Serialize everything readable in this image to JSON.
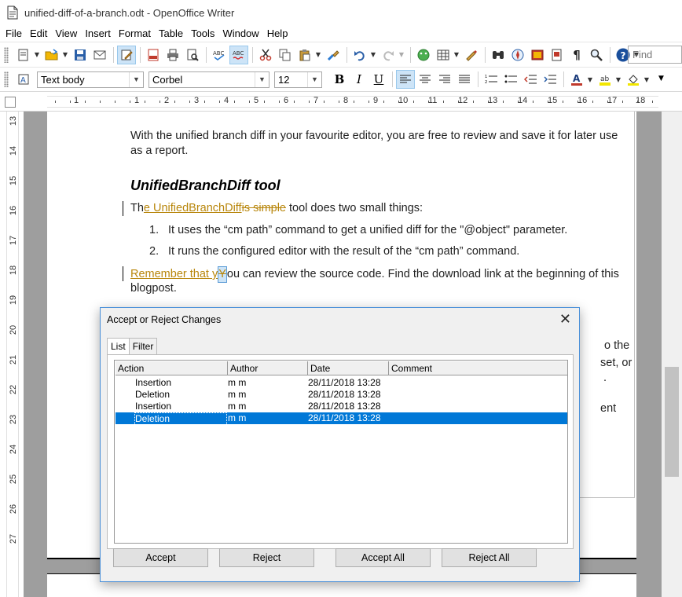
{
  "window": {
    "title": "unified-diff-of-a-branch.odt - OpenOffice Writer"
  },
  "menu": [
    "File",
    "Edit",
    "View",
    "Insert",
    "Format",
    "Table",
    "Tools",
    "Window",
    "Help"
  ],
  "toolbar": {
    "find_placeholder": "Find",
    "paragraph_style": "Text body",
    "font_name": "Corbel",
    "font_size": "12"
  },
  "ruler": {
    "top_numbers": [
      "1",
      "1",
      "2",
      "3",
      "4",
      "5",
      "6",
      "7",
      "8",
      "9",
      "10",
      "11",
      "12",
      "13",
      "14",
      "15",
      "16",
      "17",
      "18"
    ],
    "left_numbers": [
      "13",
      "14",
      "15",
      "16",
      "17",
      "18",
      "19",
      "20",
      "21",
      "22",
      "23",
      "24",
      "25",
      "26",
      "27"
    ]
  },
  "document": {
    "p1": "With the unified branch diff in your favourite editor, you are free to review and save it for later use",
    "p1b": "as a report.",
    "heading": "UnifiedBranchDiff tool",
    "p2_a": "Th",
    "p2_ins": "e UnifiedBranchDiff",
    "p2_del": "is simple",
    "p2_b": " tool does two small things:",
    "li1_num": "1.",
    "li1": "It uses the “cm path” command to get a unified diff for the \"@object\" parameter.",
    "li2_num": "2.",
    "li2": "It runs the configured editor with the result of the “cm path” command.",
    "p3_ins": "Remember that y",
    "p3_cursor": "Y",
    "p3_rest": "ou can review the source code. Find the download link at the beginning of this",
    "p3b": "blogpost.",
    "hidden_1": "o the",
    "hidden_2": "set, or",
    "hidden_3": ".",
    "hidden_4": "ent"
  },
  "dialog": {
    "title": "Accept or Reject Changes",
    "tabs": [
      "List",
      "Filter"
    ],
    "columns": [
      "Action",
      "Author",
      "Date",
      "Comment"
    ],
    "rows": [
      {
        "action": "Insertion",
        "author": "m m",
        "date": "28/11/2018 13:28",
        "comment": ""
      },
      {
        "action": "Deletion",
        "author": "m m",
        "date": "28/11/2018 13:28",
        "comment": ""
      },
      {
        "action": "Insertion",
        "author": "m m",
        "date": "28/11/2018 13:28",
        "comment": ""
      },
      {
        "action": "Deletion",
        "author": "m m",
        "date": "28/11/2018 13:28",
        "comment": ""
      }
    ],
    "selected_row": 3,
    "buttons": {
      "accept": "Accept",
      "reject": "Reject",
      "accept_all": "Accept All",
      "reject_all": "Reject All"
    }
  },
  "colors": {
    "tracked_change": "#b8860b",
    "selection": "#0078d7",
    "dialog_border": "#4a90d9"
  }
}
